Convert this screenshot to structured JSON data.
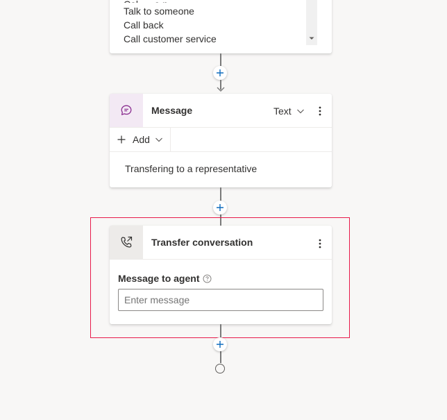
{
  "options_card": {
    "options": [
      "Talk to someone",
      "Call back",
      "Call customer service"
    ]
  },
  "message_node": {
    "title": "Message",
    "type_label": "Text",
    "add_label": "Add",
    "message_text": "Transfering to a representative",
    "icon": "chat-bubble-icon",
    "accent_bg": "#f3e9f4",
    "accent_color": "#8a2d8f"
  },
  "transfer_node": {
    "title": "Transfer conversation",
    "field_label": "Message to agent",
    "input_placeholder": "Enter message",
    "input_value": "",
    "icon": "phone-transfer-icon",
    "highlight_color": "#e8194a"
  },
  "colors": {
    "canvas": "#f8f7f6",
    "connector": "#7a7a7a",
    "plus_icon": "#0f6cbd"
  }
}
